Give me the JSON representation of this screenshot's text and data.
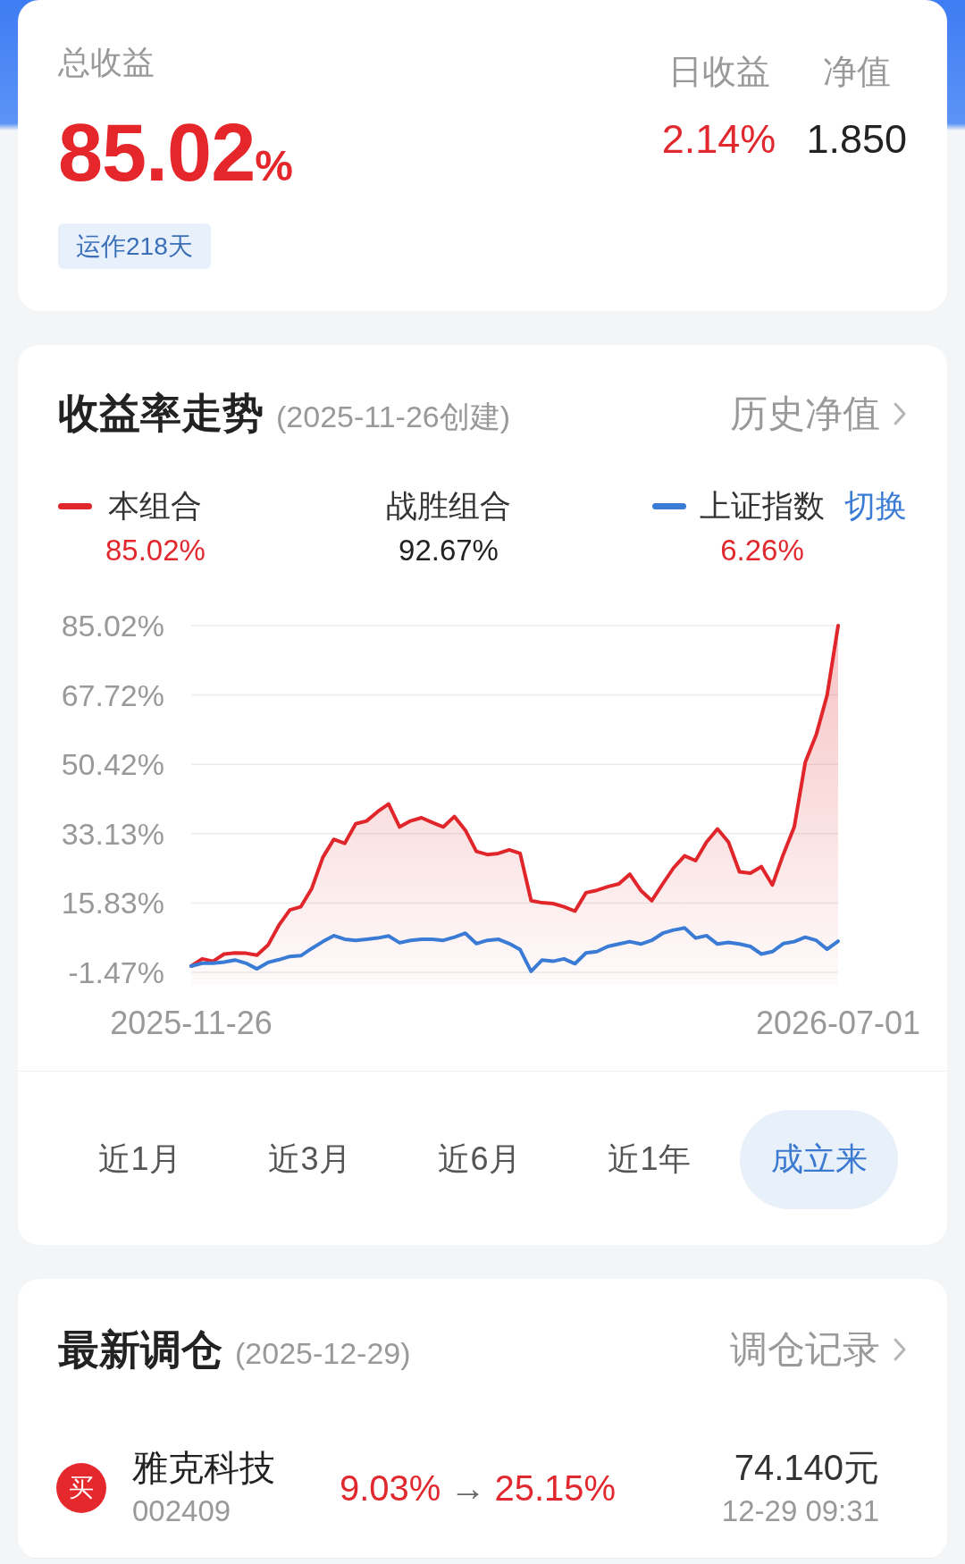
{
  "summary": {
    "total_label": "总收益",
    "total_value": "85.02",
    "total_unit": "%",
    "running": "运作218天",
    "stats": [
      {
        "kind": "change",
        "label": "日收益",
        "value": "2.14%"
      },
      {
        "kind": "plain",
        "label": "净值",
        "value": "1.850"
      }
    ]
  },
  "trend": {
    "title": "收益率走势",
    "subtitle": "(2025-11-26创建)",
    "link": "历史净值",
    "legend": [
      {
        "kind": "series",
        "value": "85.02%"
      },
      {
        "kind": "rank",
        "label": "战胜组合",
        "value": "92.67%"
      },
      {
        "kind": "series",
        "value": "6.26%",
        "action": "切换"
      }
    ],
    "chart_data": {
      "type": "area",
      "grid": true,
      "categories": [
        "2025-11-26",
        null,
        null,
        null,
        null,
        null,
        null,
        null,
        null,
        null,
        null,
        null,
        null,
        null,
        null,
        null,
        null,
        null,
        null,
        null,
        null,
        null,
        null,
        null,
        null,
        null,
        null,
        null,
        null,
        null,
        null,
        null,
        null,
        null,
        null,
        null,
        null,
        null,
        null,
        null,
        null,
        null,
        null,
        null,
        null,
        null,
        null,
        null,
        null,
        null,
        null,
        null,
        null,
        null,
        null,
        null,
        null,
        null,
        null,
        "2026-07-01"
      ],
      "ylim": [
        -1.47,
        85.02
      ],
      "yticks": [
        {
          "value": 85.02,
          "label": "85.02%"
        },
        {
          "value": 67.72,
          "label": "67.72%"
        },
        {
          "value": 50.42,
          "label": "50.42%"
        },
        {
          "value": 33.13,
          "label": "33.13%"
        },
        {
          "value": 15.83,
          "label": "15.83%"
        },
        {
          "value": -1.47,
          "label": "-1.47%"
        }
      ],
      "series": [
        {
          "name": "本组合",
          "color": "#e0262b",
          "values": [
            0.1,
            1.9,
            1.3,
            3.1,
            3.4,
            3.3,
            2.8,
            5.3,
            10.3,
            14.1,
            14.9,
            19.5,
            27.2,
            31.7,
            30.7,
            35.6,
            36.3,
            38.6,
            40.5,
            34.8,
            36.3,
            37.1,
            35.9,
            34.8,
            37.4,
            34.0,
            28.7,
            27.9,
            28.2,
            29.1,
            28.2,
            16.4,
            15.9,
            15.7,
            14.9,
            13.8,
            18.4,
            19.0,
            19.9,
            20.6,
            23.0,
            19.0,
            16.4,
            20.6,
            24.6,
            27.6,
            26.4,
            31.0,
            34.3,
            31.0,
            23.6,
            23.3,
            24.9,
            20.3,
            27.9,
            34.8,
            50.9,
            57.8,
            67.7,
            85.0
          ]
        },
        {
          "name": "上证指数",
          "type": "line",
          "color": "#3a7bd5",
          "values": [
            0.1,
            0.8,
            0.8,
            1.1,
            1.6,
            0.8,
            -0.6,
            1.0,
            1.7,
            2.5,
            2.7,
            4.5,
            6.2,
            7.7,
            6.8,
            6.5,
            6.8,
            7.1,
            7.6,
            5.9,
            6.5,
            6.8,
            6.8,
            6.5,
            7.3,
            8.3,
            5.7,
            6.5,
            6.8,
            5.7,
            4.2,
            -1.2,
            1.6,
            1.3,
            1.9,
            0.7,
            3.4,
            3.7,
            5.0,
            5.6,
            6.2,
            5.6,
            6.5,
            8.3,
            9.1,
            9.6,
            7.1,
            7.7,
            5.6,
            6.0,
            5.6,
            5.0,
            3.1,
            3.7,
            5.7,
            6.2,
            7.3,
            6.5,
            4.3,
            6.3
          ]
        }
      ]
    },
    "range_tabs": [
      {
        "label": "近1月",
        "selected": false
      },
      {
        "label": "近3月",
        "selected": false
      },
      {
        "label": "近6月",
        "selected": false
      },
      {
        "label": "近1年",
        "selected": false
      },
      {
        "label": "成立来",
        "selected": true
      }
    ]
  },
  "rebalance": {
    "title": "最新调仓",
    "subtitle": "(2025-12-29)",
    "link": "调仓记录",
    "trades": [
      {
        "kind": "buy",
        "action": "买",
        "name": "雅克科技",
        "code": "002409",
        "from": "9.03%",
        "arrow": "→",
        "to": "25.15%",
        "price": "74.140元",
        "time": "12-29 09:31"
      }
    ]
  }
}
